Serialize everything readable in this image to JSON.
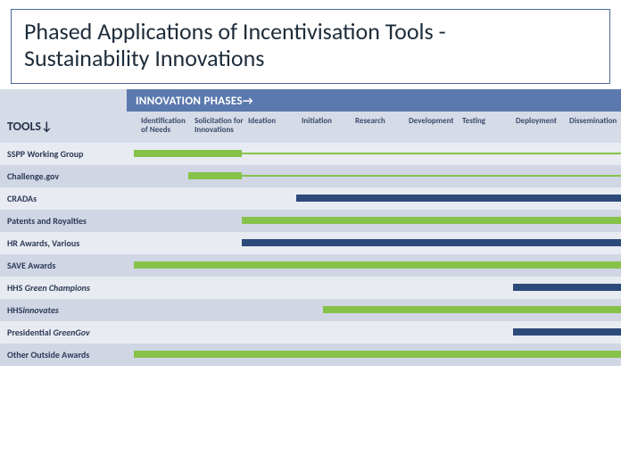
{
  "title_line1": "Phased Applications of Incentivisation Tools -",
  "title_line2": "Sustainability Innovations",
  "header_label": "INNOVATION PHASES→",
  "tools_label": "TOOLS↓",
  "columns": [
    "Identification of Needs",
    "Solicitation for Innovations",
    "Ideation",
    "Initiation",
    "Research",
    "Development",
    "Testing",
    "Deployment",
    "Dissemination"
  ],
  "rows": [
    {
      "label": "SSPP Working Group",
      "label_html": "SSPP Working Group",
      "bars": [
        {
          "color": "green",
          "thick": true,
          "from": 0,
          "to": 2
        },
        {
          "color": "green",
          "thick": false,
          "from": 2,
          "to": 9
        }
      ]
    },
    {
      "label": "Challenge.gov",
      "label_html": "Challenge.gov",
      "bars": [
        {
          "color": "green",
          "thick": true,
          "from": 1,
          "to": 2
        },
        {
          "color": "green",
          "thick": false,
          "from": 2,
          "to": 9
        }
      ]
    },
    {
      "label": "CRADAs",
      "label_html": "CRADAs",
      "bars": [
        {
          "color": "navy",
          "thick": true,
          "from": 3,
          "to": 9
        }
      ]
    },
    {
      "label": "Patents and Royalties",
      "label_html": "Patents and Royalties",
      "bars": [
        {
          "color": "green",
          "thick": true,
          "from": 2,
          "to": 9
        }
      ]
    },
    {
      "label": "HR Awards, Various",
      "label_html": "HR Awards, Various",
      "bars": [
        {
          "color": "navy",
          "thick": true,
          "from": 2,
          "to": 9
        }
      ]
    },
    {
      "label": "SAVE Awards",
      "label_html": "SAVE Awards",
      "bars": [
        {
          "color": "green",
          "thick": true,
          "from": 0,
          "to": 9
        }
      ]
    },
    {
      "label": "HHS Green Champions",
      "label_html": "HHS <span class=\"ital\">Green Champions</span>",
      "bars": [
        {
          "color": "navy",
          "thick": true,
          "from": 7,
          "to": 9
        }
      ]
    },
    {
      "label": "HHSinnovates",
      "label_html": "HHS<span class=\"ital\">innovates</span>",
      "bars": [
        {
          "color": "green",
          "thick": true,
          "from": 3.5,
          "to": 9
        }
      ]
    },
    {
      "label": "Presidential GreenGov",
      "label_html": "Presidential <span class=\"ital\">GreenGov</span>",
      "bars": [
        {
          "color": "navy",
          "thick": true,
          "from": 7,
          "to": 9
        }
      ]
    },
    {
      "label": "Other Outside Awards",
      "label_html": "Other Outside Awards",
      "bars": [
        {
          "color": "green",
          "thick": true,
          "from": 0,
          "to": 9
        }
      ]
    }
  ],
  "chart_data": {
    "type": "bar",
    "title": "Phased Applications of Incentivisation Tools - Sustainability Innovations",
    "x_axis": {
      "label": "INNOVATION PHASES",
      "categories": [
        "Identification of Needs",
        "Solicitation for Innovations",
        "Ideation",
        "Initiation",
        "Research",
        "Development",
        "Testing",
        "Deployment",
        "Dissemination"
      ]
    },
    "y_axis": {
      "label": "TOOLS",
      "categories": [
        "SSPP Working Group",
        "Challenge.gov",
        "CRADAs",
        "Patents and Royalties",
        "HR Awards, Various",
        "SAVE Awards",
        "HHS Green Champions",
        "HHSinnovates",
        "Presidential GreenGov",
        "Other Outside Awards"
      ]
    },
    "legend_inferred": [
      {
        "color": "#86c24a",
        "meaning": "green bar"
      },
      {
        "color": "#2c4a7a",
        "meaning": "navy bar"
      },
      {
        "style": "thin",
        "meaning": "continuation / secondary span"
      }
    ],
    "series": [
      {
        "tool": "SSPP Working Group",
        "segments": [
          {
            "start": "Identification of Needs",
            "end": "Solicitation for Innovations",
            "color": "green",
            "weight": "thick"
          },
          {
            "start": "Ideation",
            "end": "Dissemination",
            "color": "green",
            "weight": "thin"
          }
        ]
      },
      {
        "tool": "Challenge.gov",
        "segments": [
          {
            "start": "Solicitation for Innovations",
            "end": "Solicitation for Innovations",
            "color": "green",
            "weight": "thick"
          },
          {
            "start": "Ideation",
            "end": "Dissemination",
            "color": "green",
            "weight": "thin"
          }
        ]
      },
      {
        "tool": "CRADAs",
        "segments": [
          {
            "start": "Initiation",
            "end": "Dissemination",
            "color": "navy",
            "weight": "thick"
          }
        ]
      },
      {
        "tool": "Patents and Royalties",
        "segments": [
          {
            "start": "Ideation",
            "end": "Dissemination",
            "color": "green",
            "weight": "thick"
          }
        ]
      },
      {
        "tool": "HR Awards, Various",
        "segments": [
          {
            "start": "Ideation",
            "end": "Dissemination",
            "color": "navy",
            "weight": "thick"
          }
        ]
      },
      {
        "tool": "SAVE Awards",
        "segments": [
          {
            "start": "Identification of Needs",
            "end": "Dissemination",
            "color": "green",
            "weight": "thick"
          }
        ]
      },
      {
        "tool": "HHS Green Champions",
        "segments": [
          {
            "start": "Deployment",
            "end": "Dissemination",
            "color": "navy",
            "weight": "thick"
          }
        ]
      },
      {
        "tool": "HHSinnovates",
        "segments": [
          {
            "start": "Initiation",
            "end": "Dissemination",
            "color": "green",
            "weight": "thick"
          }
        ]
      },
      {
        "tool": "Presidential GreenGov",
        "segments": [
          {
            "start": "Deployment",
            "end": "Dissemination",
            "color": "navy",
            "weight": "thick"
          }
        ]
      },
      {
        "tool": "Other Outside Awards",
        "segments": [
          {
            "start": "Identification of Needs",
            "end": "Dissemination",
            "color": "green",
            "weight": "thick"
          }
        ]
      }
    ]
  }
}
